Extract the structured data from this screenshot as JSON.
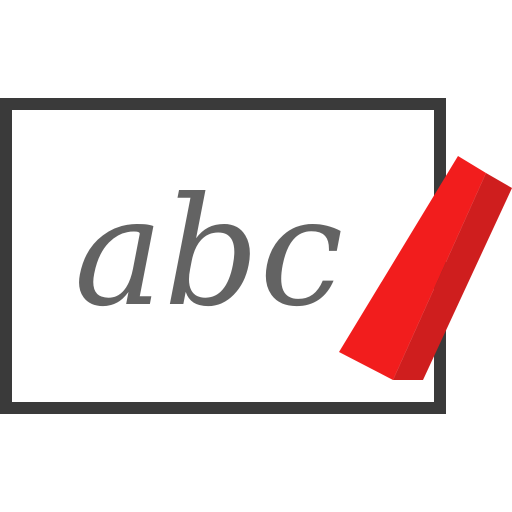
{
  "icon": {
    "name": "handwriting-board-icon",
    "text": "abc",
    "colors": {
      "frame": "#3a3a3a",
      "board": "#ffffff",
      "text": "#636363",
      "chalk_light": "#f21d1d",
      "chalk_dark": "#cf1e1e"
    }
  }
}
